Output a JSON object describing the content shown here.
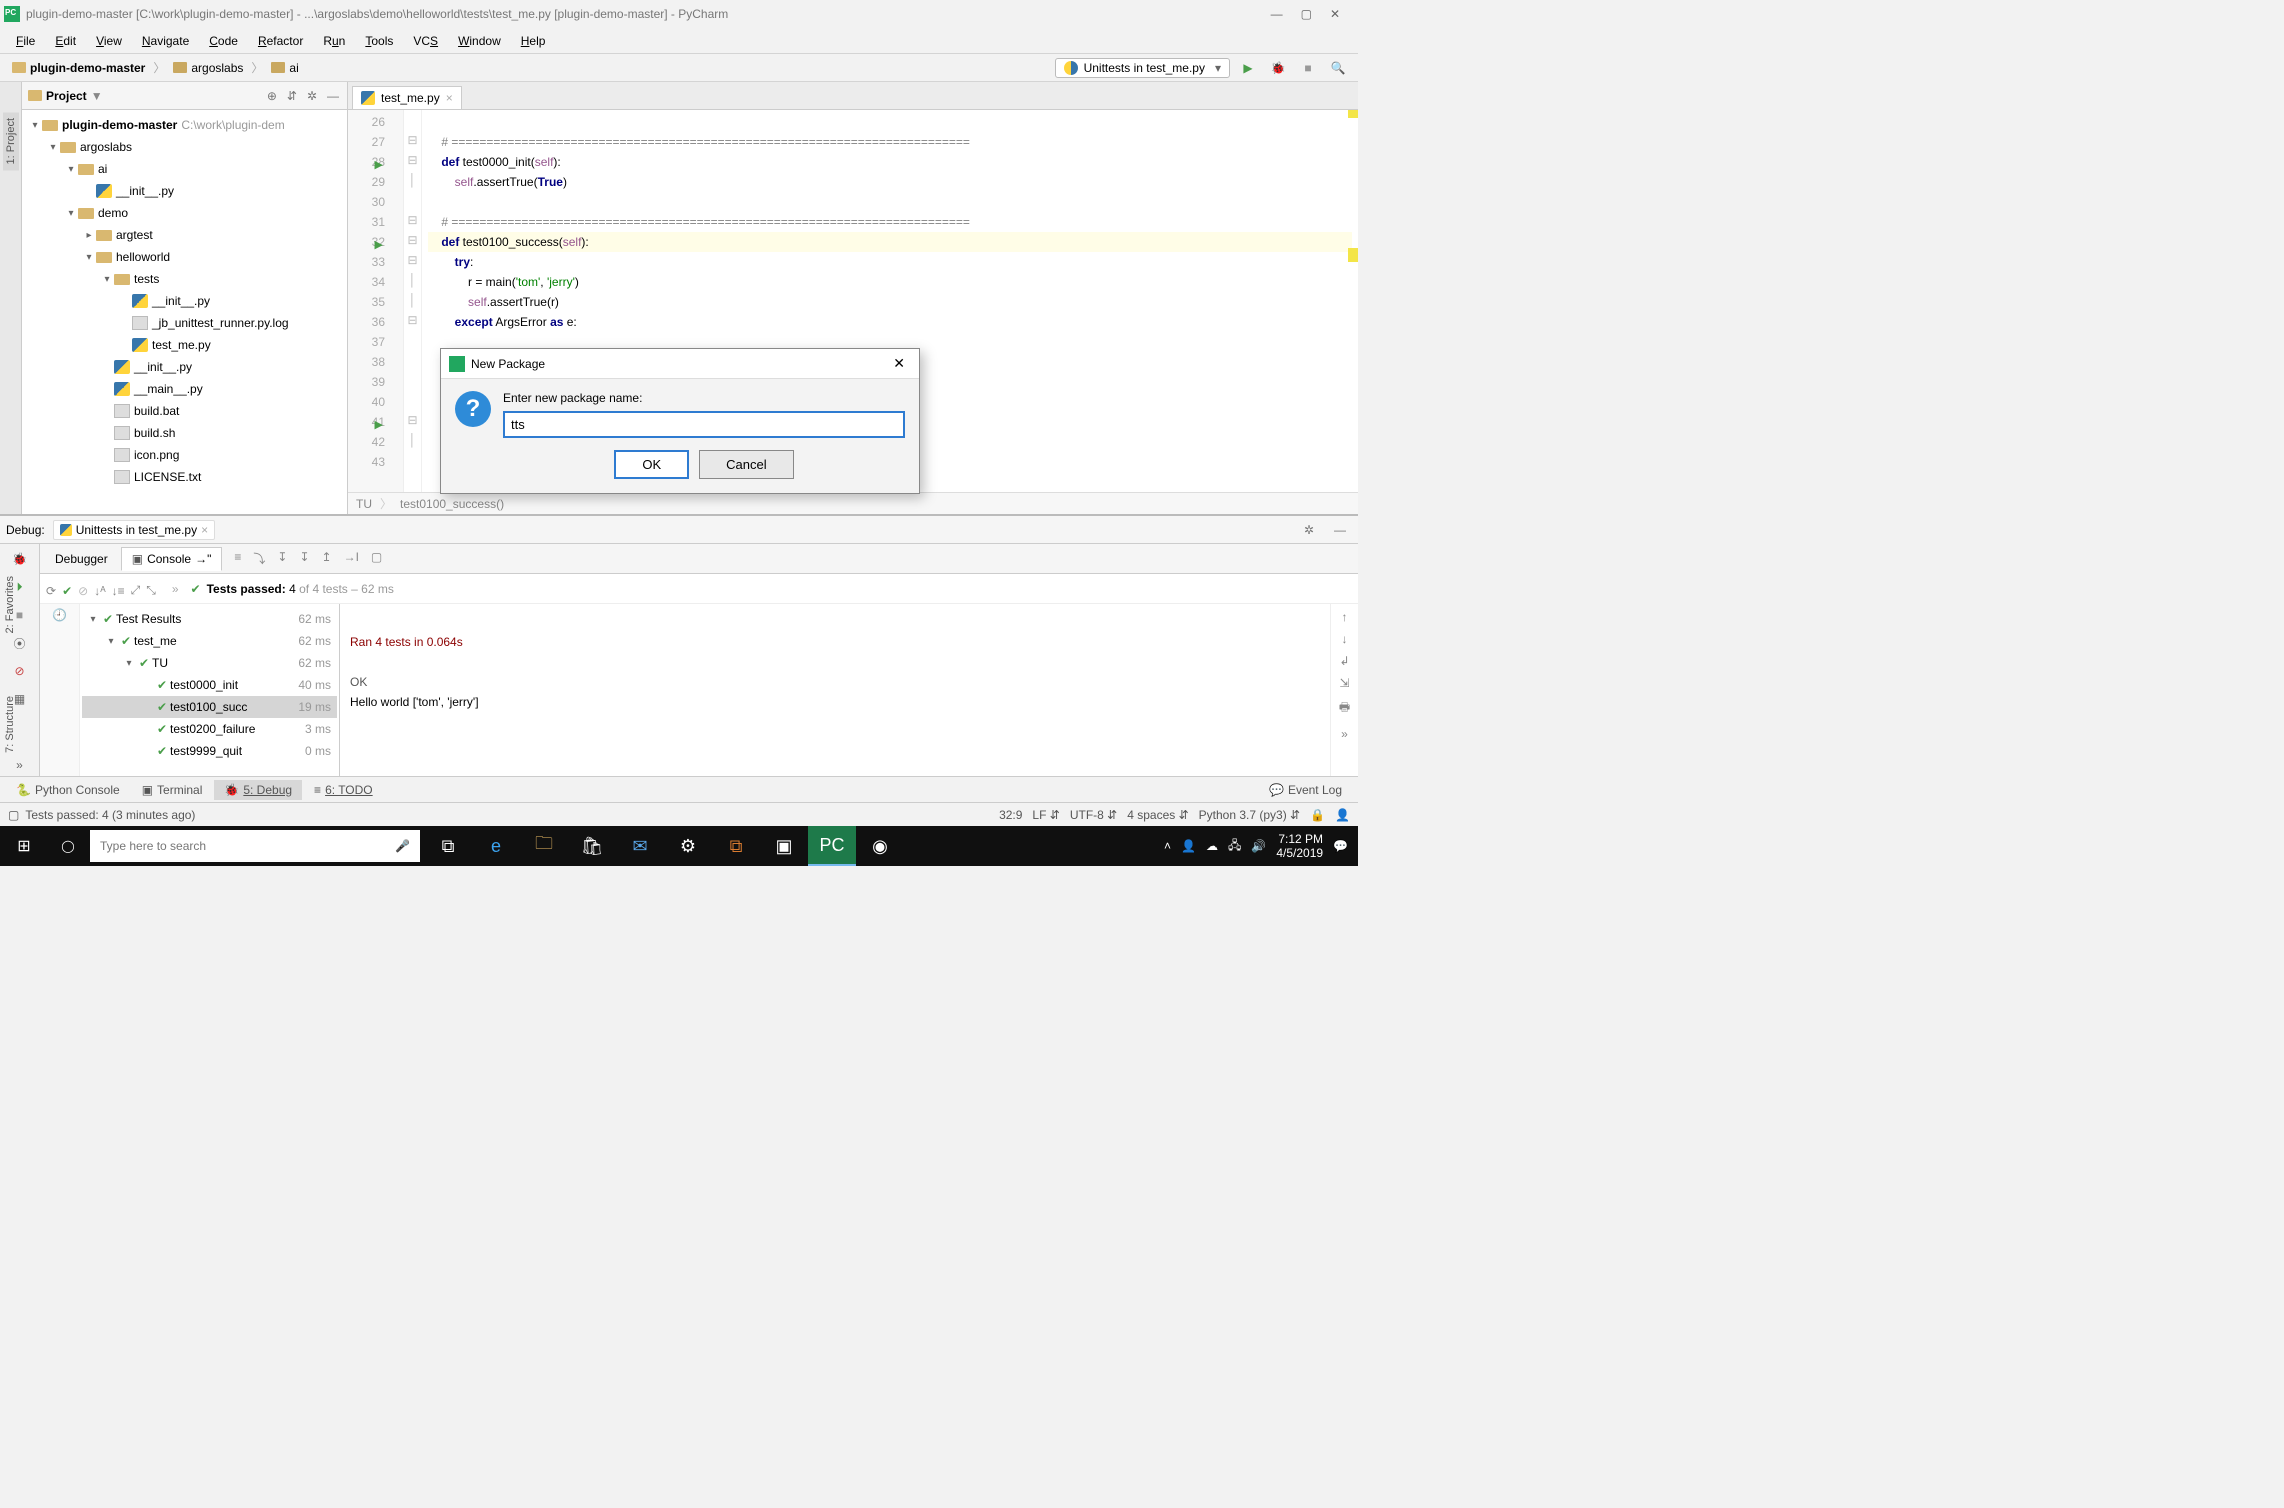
{
  "window": {
    "title": "plugin-demo-master [C:\\work\\plugin-demo-master] - ...\\argoslabs\\demo\\helloworld\\tests\\test_me.py [plugin-demo-master] - PyCharm"
  },
  "menu": [
    "File",
    "Edit",
    "View",
    "Navigate",
    "Code",
    "Refactor",
    "Run",
    "Tools",
    "VCS",
    "Window",
    "Help"
  ],
  "breadcrumb": [
    "plugin-demo-master",
    "argoslabs",
    "ai"
  ],
  "run_config": {
    "label": "Unittests in test_me.py"
  },
  "side_tabs": {
    "project": "1: Project",
    "favorites": "2: Favorites",
    "structure": "7: Structure"
  },
  "project_panel": {
    "title": "Project"
  },
  "tree": {
    "root": {
      "name": "plugin-demo-master",
      "path": "C:\\work\\plugin-dem"
    },
    "nodes": [
      {
        "indent": 0,
        "arrow": "▾",
        "icon": "folder",
        "label": "plugin-demo-master",
        "muted": "C:\\work\\plugin-dem"
      },
      {
        "indent": 1,
        "arrow": "▾",
        "icon": "folder",
        "label": "argoslabs"
      },
      {
        "indent": 2,
        "arrow": "▾",
        "icon": "folder",
        "label": "ai"
      },
      {
        "indent": 3,
        "arrow": "",
        "icon": "pyfile",
        "label": "__init__.py"
      },
      {
        "indent": 2,
        "arrow": "▾",
        "icon": "folder",
        "label": "demo"
      },
      {
        "indent": 3,
        "arrow": "▸",
        "icon": "folder",
        "label": "argtest"
      },
      {
        "indent": 3,
        "arrow": "▾",
        "icon": "folder",
        "label": "helloworld"
      },
      {
        "indent": 4,
        "arrow": "▾",
        "icon": "folder",
        "label": "tests"
      },
      {
        "indent": 5,
        "arrow": "",
        "icon": "pyfile",
        "label": "__init__.py"
      },
      {
        "indent": 5,
        "arrow": "",
        "icon": "file",
        "label": "_jb_unittest_runner.py.log"
      },
      {
        "indent": 5,
        "arrow": "",
        "icon": "pyfile",
        "label": "test_me.py"
      },
      {
        "indent": 4,
        "arrow": "",
        "icon": "pyfile",
        "label": "__init__.py"
      },
      {
        "indent": 4,
        "arrow": "",
        "icon": "pyfile",
        "label": "__main__.py"
      },
      {
        "indent": 4,
        "arrow": "",
        "icon": "file",
        "label": "build.bat"
      },
      {
        "indent": 4,
        "arrow": "",
        "icon": "file",
        "label": "build.sh"
      },
      {
        "indent": 4,
        "arrow": "",
        "icon": "file",
        "label": "icon.png"
      },
      {
        "indent": 4,
        "arrow": "",
        "icon": "file",
        "label": "LICENSE.txt"
      }
    ]
  },
  "editor": {
    "tab": "test_me.py",
    "first_line": 26,
    "crumb": [
      "TU",
      "test0100_success()"
    ],
    "lines": [
      "",
      "    # ==========================================================================",
      "    def test0000_init(self):",
      "        self.assertTrue(True)",
      "",
      "    # ==========================================================================",
      "    def test0100_success(self):",
      "        try:",
      "            r = main('tom', 'jerry')",
      "            self.assertTrue(r)",
      "        except ArgsError as e:",
      "",
      "",
      "",
      "",
      "",
      "",
      ""
    ]
  },
  "debug": {
    "label": "Debug:",
    "tab_name": "Unittests in test_me.py",
    "tabs": {
      "debugger": "Debugger",
      "console": "Console"
    },
    "tests_summary": {
      "prefix": "Tests passed: ",
      "passed": "4",
      "mid": " of 4 tests – ",
      "time": "62 ms"
    },
    "tree": [
      {
        "indent": 0,
        "arrow": "▾",
        "label": "Test Results",
        "time": "62 ms"
      },
      {
        "indent": 1,
        "arrow": "▾",
        "label": "test_me",
        "time": "62 ms"
      },
      {
        "indent": 2,
        "arrow": "▾",
        "label": "TU",
        "time": "62 ms"
      },
      {
        "indent": 3,
        "arrow": "",
        "label": "test0000_init",
        "time": "40 ms"
      },
      {
        "indent": 3,
        "arrow": "",
        "label": "test0100_succ",
        "time": "19 ms",
        "sel": true
      },
      {
        "indent": 3,
        "arrow": "",
        "label": "test0200_failure",
        "time": "3 ms"
      },
      {
        "indent": 3,
        "arrow": "",
        "label": "test9999_quit",
        "time": "0 ms"
      }
    ],
    "console": {
      "ran": "Ran 4 tests in 0.064s",
      "ok": "OK",
      "out": "Hello world ['tom', 'jerry']"
    }
  },
  "bottom_tools": {
    "python": "Python Console",
    "terminal": "Terminal",
    "debug": "5: Debug",
    "todo": "6: TODO",
    "eventlog": "Event Log"
  },
  "statusbar": {
    "msg": "Tests passed: 4 (3 minutes ago)",
    "pos": "32:9",
    "lf": "LF",
    "enc": "UTF-8",
    "indent": "4 spaces",
    "interp": "Python 3.7 (py3)"
  },
  "taskbar": {
    "search_placeholder": "Type here to search",
    "time": "7:12 PM",
    "date": "4/5/2019"
  },
  "dialog": {
    "title": "New Package",
    "label": "Enter new package name:",
    "value": "tts",
    "ok": "OK",
    "cancel": "Cancel"
  }
}
